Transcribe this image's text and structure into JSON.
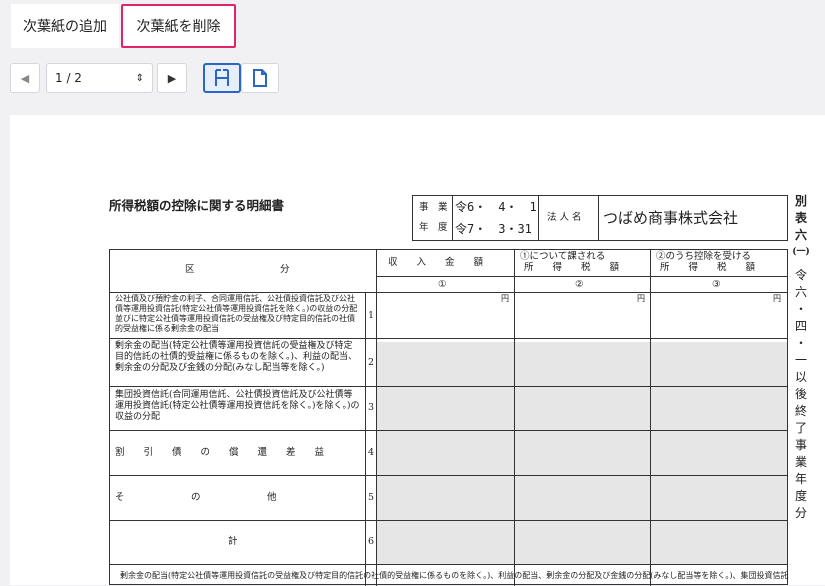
{
  "tabs": [
    {
      "label": "次葉紙の追加"
    },
    {
      "label": "次葉紙を削除"
    }
  ],
  "toolbar": {
    "prev_icon": "chevron-left-icon",
    "page_value": "1 / 2",
    "next_icon": "chevron-right-icon",
    "view_fit_icon": "fit-width-icon",
    "view_page_icon": "document-icon"
  },
  "form": {
    "title": "所得税額の控除に関する明細書",
    "jigyo": "事　業",
    "nendo": "年　度",
    "from_date": "令6・　4・　1",
    "to_date": "令7・　3・31",
    "hojin_label": "法 人 名",
    "hojin_name": "つばめ商事株式会社",
    "side_label": [
      "別",
      "表",
      "六",
      "(一)"
    ],
    "side_note": [
      "令",
      "六",
      "・",
      "四",
      "・",
      "一",
      "以",
      "後",
      "終",
      "了",
      "事",
      "業",
      "年",
      "度",
      "分"
    ],
    "col_kubun": "区　　　　　　　　　分",
    "col1": "収　　入　　金　　額",
    "col2a": "①について課される",
    "col2b": "所　　得　　税　　額",
    "col3a": "②のうち控除を受ける",
    "col3b": "所　　得　　税　　額",
    "num1": "①",
    "num2": "②",
    "num3": "③",
    "yen": "円",
    "rows": [
      {
        "text": "公社債及び預貯金の利子、合同運用信託、公社債投資信託及び公社債等運用投資信託(特定公社債等運用投資信託を除く。)の収益の分配並びに特定公社債等運用投資信託の受益権及び特定目的信託の社債的受益権に係る剰余金の配当",
        "no": "1"
      },
      {
        "text": "剰余金の配当(特定公社債等運用投資信託の受益権及び特定目的信託の社債的受益権に係るものを除く。)、利益の配当、剰余金の分配及び金銭の分配(みなし配当等を除く。)",
        "no": "2"
      },
      {
        "text": "集団投資信託(合同運用信託、公社債投資信託及び公社債等運用投資信託(特定公社債等運用投資信託を除く。)を除く。)の収益の分配",
        "no": "3"
      },
      {
        "text": "割　　引　　債　　の　　償　　還　　差　　益",
        "no": "4"
      },
      {
        "text": "そ　　　　　　　の　　　　　　　他",
        "no": "5"
      },
      {
        "text": "計",
        "no": "6"
      }
    ],
    "footer": "剰余金の配当(特定公社債等運用投資信託の受益権及び特定目的信託の社債的受益権に係るものを除く。)、利益の配当、剰余金の分配及び金銭の分配(みなし配当等を除く。)、集団投資信託"
  }
}
